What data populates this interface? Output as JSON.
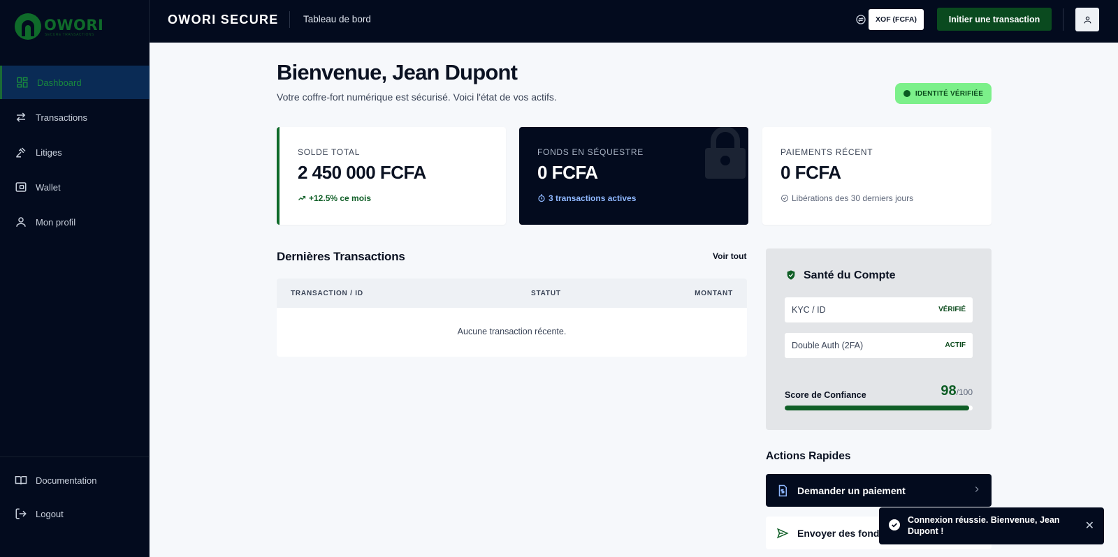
{
  "logo": {
    "text": "OWORI",
    "sub": "SECURE TRANSACTIONS"
  },
  "sidebar": {
    "items": [
      {
        "label": "Dashboard",
        "icon": "dashboard-icon"
      },
      {
        "label": "Transactions",
        "icon": "swap-icon"
      },
      {
        "label": "Litiges",
        "icon": "gavel-icon"
      },
      {
        "label": "Wallet",
        "icon": "wallet-icon"
      },
      {
        "label": "Mon profil",
        "icon": "user-icon"
      }
    ],
    "bottom": [
      {
        "label": "Documentation",
        "icon": "book-icon"
      },
      {
        "label": "Logout",
        "icon": "logout-icon"
      }
    ]
  },
  "topbar": {
    "brand": "OWORI SECURE",
    "crumb": "Tableau de bord",
    "currency": "XOF (FCFA)",
    "initiate": "Initier une transaction"
  },
  "main": {
    "welcome": "Bienvenue, Jean Dupont",
    "subtitle": "Votre coffre-fort numérique est sécurisé. Voici l'état de vos actifs.",
    "badge": "IDENTITÉ VÉRIFIÉE",
    "cards": [
      {
        "label": "SOLDE TOTAL",
        "value": "2 450 000 FCFA",
        "foot": "+12.5% ce mois"
      },
      {
        "label": "FONDS EN SÉQUESTRE",
        "value": "0 FCFA",
        "foot": "3 transactions actives"
      },
      {
        "label": "PAIEMENTS RÉCENT",
        "value": "0 FCFA",
        "foot": "Libérations des 30 derniers jours"
      }
    ],
    "transactions": {
      "title": "Dernières Transactions",
      "see_all": "Voir tout",
      "columns": [
        "TRANSACTION / ID",
        "STATUT",
        "MONTANT"
      ],
      "empty": "Aucune transaction récente."
    }
  },
  "health": {
    "title": "Santé du Compte",
    "rows": [
      {
        "label": "KYC / ID",
        "status": "VÉRIFIÉ"
      },
      {
        "label": "Double Auth (2FA)",
        "status": "ACTIF"
      }
    ],
    "score_label": "Score de Confiance",
    "score": "98",
    "score_max": "/100",
    "score_fraction": 0.98
  },
  "quick_actions": {
    "title": "Actions Rapides",
    "items": [
      {
        "label": "Demander un paiement",
        "icon": "invoice-icon"
      },
      {
        "label": "Envoyer des fonds",
        "icon": "send-icon"
      }
    ]
  },
  "toast": {
    "message": "Connexion réussie. Bienvenue, Jean Dupont !"
  },
  "colors": {
    "accent": "#0f6b2a",
    "navy": "#030b1e",
    "badge": "#7cf08a"
  }
}
